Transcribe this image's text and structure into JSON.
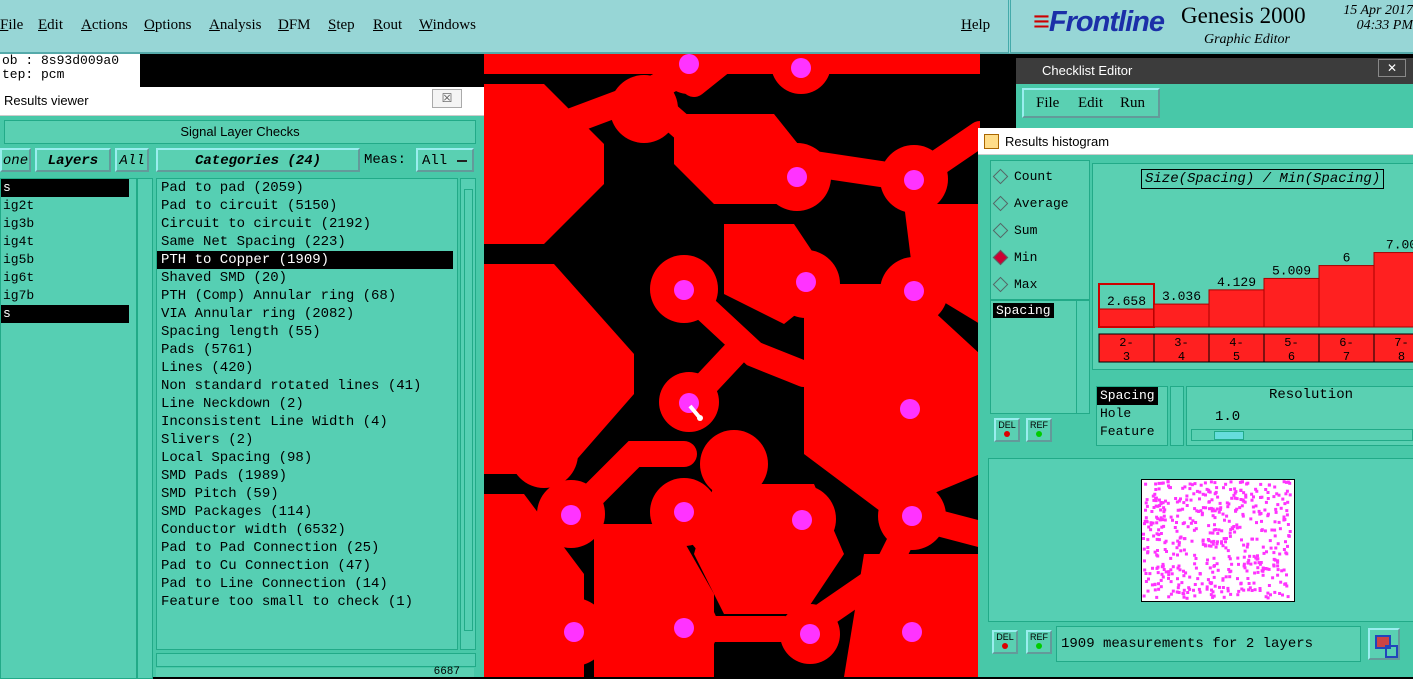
{
  "menubar": {
    "items": [
      "File",
      "Edit",
      "Actions",
      "Options",
      "Analysis",
      "DFM",
      "Step",
      "Rout",
      "Windows"
    ],
    "help": "Help"
  },
  "brand": {
    "logo": "Frontline",
    "product": "Genesis 2000",
    "subtitle": "Graphic Editor",
    "date": "15 Apr 2017",
    "time": "04:33 PM"
  },
  "job": {
    "line1": "ob : 8s93d009a0",
    "line2": "tep: pcm"
  },
  "results_viewer": {
    "title": "Results viewer",
    "close": "☒",
    "header": "Signal Layer Checks",
    "none_btn": "one",
    "layers_btn": "Layers",
    "all_btn": "All",
    "categories_btn": "Categories (24)",
    "meas_label": "Meas:",
    "meas_value": "All",
    "layers": [
      {
        "label": "s",
        "selected": true
      },
      {
        "label": "ig2t",
        "selected": false
      },
      {
        "label": "ig3b",
        "selected": false
      },
      {
        "label": "ig4t",
        "selected": false
      },
      {
        "label": "ig5b",
        "selected": false
      },
      {
        "label": "ig6t",
        "selected": false
      },
      {
        "label": "ig7b",
        "selected": false
      },
      {
        "label": "s",
        "selected": true
      }
    ],
    "categories": [
      {
        "label": "Pad to pad (2059)",
        "selected": false
      },
      {
        "label": "Pad to circuit (5150)",
        "selected": false
      },
      {
        "label": "Circuit to circuit (2192)",
        "selected": false
      },
      {
        "label": "Same Net Spacing (223)",
        "selected": false
      },
      {
        "label": "PTH to Copper (1909)",
        "selected": true
      },
      {
        "label": "Shaved SMD (20)",
        "selected": false
      },
      {
        "label": "PTH (Comp) Annular ring (68)",
        "selected": false
      },
      {
        "label": "VIA Annular ring (2082)",
        "selected": false
      },
      {
        "label": "Spacing length (55)",
        "selected": false
      },
      {
        "label": "Pads (5761)",
        "selected": false
      },
      {
        "label": "Lines (420)",
        "selected": false
      },
      {
        "label": "Non standard rotated lines (41)",
        "selected": false
      },
      {
        "label": "Line Neckdown (2)",
        "selected": false
      },
      {
        "label": "Inconsistent Line Width (4)",
        "selected": false
      },
      {
        "label": "Slivers (2)",
        "selected": false
      },
      {
        "label": "Local Spacing (98)",
        "selected": false
      },
      {
        "label": "SMD Pads (1989)",
        "selected": false
      },
      {
        "label": "SMD Pitch (59)",
        "selected": false
      },
      {
        "label": "SMD Packages (114)",
        "selected": false
      },
      {
        "label": "Conductor width (6532)",
        "selected": false
      },
      {
        "label": "Pad to Pad Connection (25)",
        "selected": false
      },
      {
        "label": "Pad to Cu Connection (47)",
        "selected": false
      },
      {
        "label": "Pad to Line Connection (14)",
        "selected": false
      },
      {
        "label": "Feature too small to check (1)",
        "selected": false
      }
    ],
    "bottom_value": "6687"
  },
  "checklist_editor": {
    "title": "Checklist Editor",
    "close": "✕",
    "menu": [
      "File",
      "Edit",
      "Run"
    ]
  },
  "histogram": {
    "title": "Results histogram",
    "close": "✕",
    "radios": [
      {
        "label": "Count",
        "on": false
      },
      {
        "label": "Average",
        "on": false
      },
      {
        "label": "Sum",
        "on": false
      },
      {
        "label": "Min",
        "on": true
      },
      {
        "label": "Max",
        "on": false
      }
    ],
    "list_item": "Spacing",
    "chart_title": "Size(Spacing) / Min(Spacing)",
    "bars": [
      {
        "value": "2.658",
        "range": "2-3",
        "highlight": true
      },
      {
        "value": "3.036",
        "range": "3-4",
        "highlight": false
      },
      {
        "value": "4.129",
        "range": "4-5",
        "highlight": false
      },
      {
        "value": "5.009",
        "range": "5-6",
        "highlight": false
      },
      {
        "value": "6",
        "range": "6-7",
        "highlight": false
      },
      {
        "value": "7.00",
        "range": "7-8",
        "highlight": false
      }
    ],
    "mode_items": [
      {
        "label": "Spacing",
        "selected": true
      },
      {
        "label": "Hole",
        "selected": false
      },
      {
        "label": "Feature",
        "selected": false
      }
    ],
    "resolution_label": "Resolution",
    "resolution_value": "1.0",
    "del_label": "DEL",
    "ref_label": "REF",
    "status": "1909 measurements for 2 layers"
  },
  "colors": {
    "panel": "#48c8a8",
    "copper": "#ff0000",
    "pad_center": "#ff33ff",
    "bar": "#ff2020"
  }
}
